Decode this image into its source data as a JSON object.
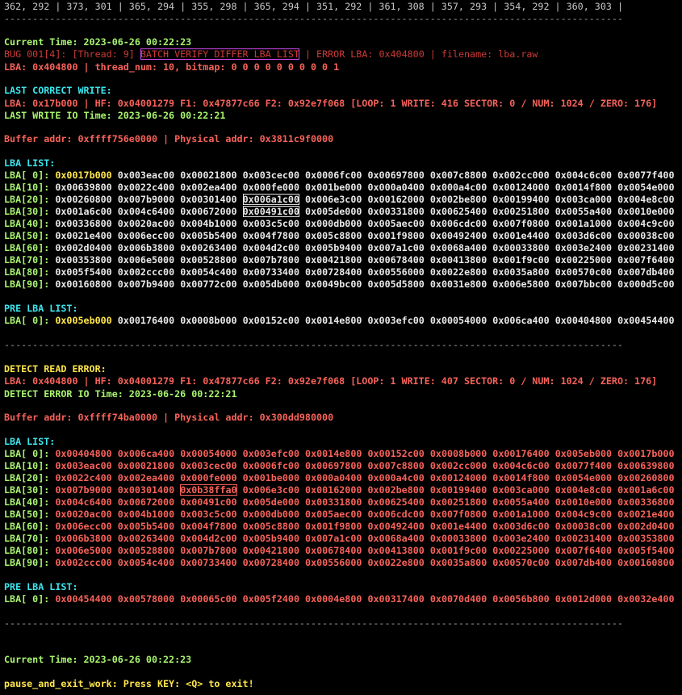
{
  "top_line": "362, 292 | 373, 301 | 365, 294 | 355, 298 | 365, 294 | 351, 292 | 361, 308 | 357, 293 | 354, 292 | 360, 303 |",
  "separator": "-------------------------------------------------------------------------------------------------------------",
  "current_time_1": "Current Time: 2023-06-26 00:22:23",
  "bug": {
    "prefix": "BUG 001[4]: [Thread: 9]",
    "boxed": "BATCH VERIFY DIFFER LBA LIST",
    "suffix": "| ERROR LBA: 0x404800 | filename: lba.raw"
  },
  "lba_thread_line": "LBA: 0x404800 | thread_num: 10, bitmap: 0 0 0 0 0 0 0 0 0 1",
  "last_correct": {
    "heading": "LAST CORRECT WRITE:",
    "info": "LBA: 0x17b000 | HF: 0x04001279 F1: 0x47877c66 F2: 0x92e7f068 [LOOP: 1 WRITE: 416 SECTOR: 0 / NUM: 1024 / ZERO: 176]",
    "io_time": "LAST WRITE IO Time: 2023-06-26 00:22:21",
    "buffer": "Buffer addr: 0xffff756e0000 | Physical addr: 0x3811c9f0000",
    "lba_list_label": "LBA LIST:",
    "rows": [
      {
        "label": "LBA[ 0]:",
        "values": [
          "0x0017b000",
          "0x003eac00",
          "0x00021800",
          "0x003cec00",
          "0x0006fc00",
          "0x00697800",
          "0x007c8800",
          "0x002cc000",
          "0x004c6c00",
          "0x0077f400"
        ]
      },
      {
        "label": "LBA[10]:",
        "values": [
          "0x00639800",
          "0x0022c400",
          "0x002ea400",
          "0x000fe000",
          "0x001be000",
          "0x000a0400",
          "0x000a4c00",
          "0x00124000",
          "0x0014f800",
          "0x0054e000"
        ]
      },
      {
        "label": "LBA[20]:",
        "values": [
          "0x00260800",
          "0x007b9000",
          "0x00301400",
          "0x006a1c00",
          "0x006e3c00",
          "0x00162000",
          "0x002be800",
          "0x00199400",
          "0x003ca000",
          "0x004e8c00"
        ]
      },
      {
        "label": "LBA[30]:",
        "values": [
          "0x001a6c00",
          "0x004c6400",
          "0x00672000",
          "0x00491c00",
          "0x005de000",
          "0x00331800",
          "0x00625400",
          "0x00251800",
          "0x0055a400",
          "0x0010e000"
        ]
      },
      {
        "label": "LBA[40]:",
        "values": [
          "0x00336800",
          "0x0020ac00",
          "0x004b1000",
          "0x003c5c00",
          "0x000db000",
          "0x005aec00",
          "0x006cdc00",
          "0x007f0800",
          "0x001a1000",
          "0x004c9c00"
        ]
      },
      {
        "label": "LBA[50]:",
        "values": [
          "0x0021e400",
          "0x006ecc00",
          "0x005b5400",
          "0x004f7800",
          "0x005c8800",
          "0x001f9800",
          "0x00492400",
          "0x001e4400",
          "0x003d6c00",
          "0x00038c00"
        ]
      },
      {
        "label": "LBA[60]:",
        "values": [
          "0x002d0400",
          "0x006b3800",
          "0x00263400",
          "0x004d2c00",
          "0x005b9400",
          "0x007a1c00",
          "0x0068a400",
          "0x00033800",
          "0x003e2400",
          "0x00231400"
        ]
      },
      {
        "label": "LBA[70]:",
        "values": [
          "0x00353800",
          "0x006e5000",
          "0x00528800",
          "0x007b7800",
          "0x00421800",
          "0x00678400",
          "0x00413800",
          "0x001f9c00",
          "0x00225000",
          "0x007f6400"
        ]
      },
      {
        "label": "LBA[80]:",
        "values": [
          "0x005f5400",
          "0x002ccc00",
          "0x0054c400",
          "0x00733400",
          "0x00728400",
          "0x00556000",
          "0x0022e800",
          "0x0035a800",
          "0x00570c00",
          "0x007db400"
        ]
      },
      {
        "label": "LBA[90]:",
        "values": [
          "0x00160800",
          "0x007b9400",
          "0x00772c00",
          "0x005db000",
          "0x0049bc00",
          "0x005d5800",
          "0x0031e800",
          "0x006e5800",
          "0x007bbc00",
          "0x000d5c00"
        ]
      }
    ],
    "pre_label": "PRE LBA LIST:",
    "pre_row": {
      "label": "LBA[ 0]:",
      "values": [
        "0x005eb000",
        "0x00176400",
        "0x0008b000",
        "0x00152c00",
        "0x0014e800",
        "0x003efc00",
        "0x00054000",
        "0x006ca400",
        "0x00404800",
        "0x00454400"
      ]
    }
  },
  "detect": {
    "heading": "DETECT READ ERROR:",
    "info": "LBA: 0x404800 | HF: 0x04001279 F1: 0x47877c66 F2: 0x92e7f068 [LOOP: 1 WRITE: 407 SECTOR: 0 / NUM: 1024 / ZERO: 176]",
    "io_time": "DETECT ERROR IO Time: 2023-06-26 00:22:21",
    "buffer": "Buffer addr: 0xffff74ba0000 | Physical addr: 0x300dd980000",
    "lba_list_label": "LBA LIST:",
    "rows": [
      {
        "label": "LBA[ 0]:",
        "values": [
          "0x00404800",
          "0x006ca400",
          "0x00054000",
          "0x003efc00",
          "0x0014e800",
          "0x00152c00",
          "0x0008b000",
          "0x00176400",
          "0x005eb000",
          "0x0017b000"
        ]
      },
      {
        "label": "LBA[10]:",
        "values": [
          "0x003eac00",
          "0x00021800",
          "0x003cec00",
          "0x0006fc00",
          "0x00697800",
          "0x007c8800",
          "0x002cc000",
          "0x004c6c00",
          "0x0077f400",
          "0x00639800"
        ]
      },
      {
        "label": "LBA[20]:",
        "values": [
          "0x0022c400",
          "0x002ea400",
          "0x000fe000",
          "0x001be000",
          "0x000a0400",
          "0x000a4c00",
          "0x00124000",
          "0x0014f800",
          "0x0054e000",
          "0x00260800"
        ]
      },
      {
        "label": "LBA[30]:",
        "values": [
          "0x007b9000",
          "0x00301400",
          "0x0b38ffa0",
          "0x006e3c00",
          "0x00162000",
          "0x002be800",
          "0x00199400",
          "0x003ca000",
          "0x004e8c00",
          "0x001a6c00"
        ]
      },
      {
        "label": "LBA[40]:",
        "values": [
          "0x004c6400",
          "0x00672000",
          "0x00491c00",
          "0x005de000",
          "0x00331800",
          "0x00625400",
          "0x00251800",
          "0x0055a400",
          "0x0010e000",
          "0x00336800"
        ]
      },
      {
        "label": "LBA[50]:",
        "values": [
          "0x0020ac00",
          "0x004b1000",
          "0x003c5c00",
          "0x000db000",
          "0x005aec00",
          "0x006cdc00",
          "0x007f0800",
          "0x001a1000",
          "0x004c9c00",
          "0x0021e400"
        ]
      },
      {
        "label": "LBA[60]:",
        "values": [
          "0x006ecc00",
          "0x005b5400",
          "0x004f7800",
          "0x005c8800",
          "0x001f9800",
          "0x00492400",
          "0x001e4400",
          "0x003d6c00",
          "0x00038c00",
          "0x002d0400"
        ]
      },
      {
        "label": "LBA[70]:",
        "values": [
          "0x006b3800",
          "0x00263400",
          "0x004d2c00",
          "0x005b9400",
          "0x007a1c00",
          "0x0068a400",
          "0x00033800",
          "0x003e2400",
          "0x00231400",
          "0x00353800"
        ]
      },
      {
        "label": "LBA[80]:",
        "values": [
          "0x006e5000",
          "0x00528800",
          "0x007b7800",
          "0x00421800",
          "0x00678400",
          "0x00413800",
          "0x001f9c00",
          "0x00225000",
          "0x007f6400",
          "0x005f5400"
        ]
      },
      {
        "label": "LBA[90]:",
        "values": [
          "0x002ccc00",
          "0x0054c400",
          "0x00733400",
          "0x00728400",
          "0x00556000",
          "0x0022e800",
          "0x0035a800",
          "0x00570c00",
          "0x007db400",
          "0x00160800"
        ]
      }
    ],
    "pre_label": "PRE LBA LIST:",
    "pre_row": {
      "label": "LBA[ 0]:",
      "values": [
        "0x00454400",
        "0x00578000",
        "0x00065c00",
        "0x005f2400",
        "0x0004e800",
        "0x00317400",
        "0x0070d400",
        "0x0056b800",
        "0x0012d000",
        "0x0032e400"
      ]
    }
  },
  "current_time_2": "Current Time: 2023-06-26 00:22:23",
  "exit_prompt": "pause_and_exit_work: Press KEY: <Q> to exit!"
}
